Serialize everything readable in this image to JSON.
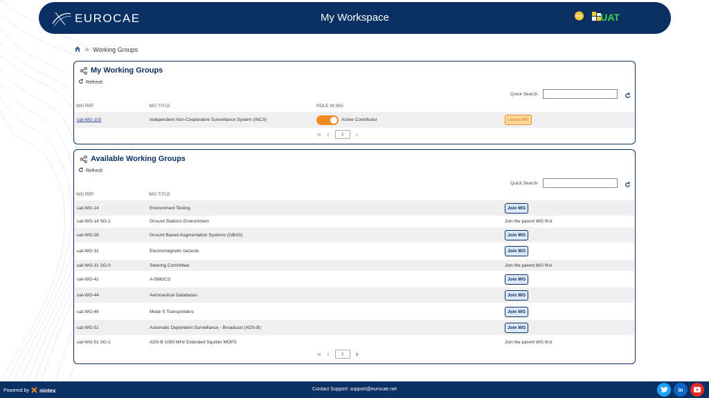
{
  "header": {
    "logo_text": "EUROCAE",
    "title": "My Workspace",
    "env_label": "UAT",
    "icons": [
      "chat-icon",
      "org-chart-icon"
    ]
  },
  "breadcrumb": {
    "current": "Working Groups"
  },
  "my_groups": {
    "title": "My Working Groups",
    "refresh_label": "Refresh",
    "quick_search_label": "Quick Search:",
    "columns": {
      "ref": "WG REF",
      "title": "WG TITLE",
      "role": "ROLE IN WG"
    },
    "rows": [
      {
        "ref": "uat-WG-103",
        "title": "Independent Non-Cooperative Surveillance System (INCS)",
        "role": "Active Contributor",
        "action": "Leave WG"
      }
    ],
    "page": "1"
  },
  "available_groups": {
    "title": "Available Working Groups",
    "refresh_label": "Refresh",
    "quick_search_label": "Quick Search:",
    "columns": {
      "ref": "WG REF",
      "title": "WG TITLE"
    },
    "rows": [
      {
        "ref": "uat-WG-14",
        "title": "Environment Testing",
        "action": "Join WG"
      },
      {
        "ref": "uat-WG-14 SG-1",
        "title": "Ground Stations Environment",
        "action": "Join the parent WG first"
      },
      {
        "ref": "uat-WG-28",
        "title": "Ground Based Augmentation Systems (GBAS)",
        "action": "Join WG"
      },
      {
        "ref": "uat-WG-31",
        "title": "Electromagnetic hazards",
        "action": "Join WG"
      },
      {
        "ref": "uat-WG-31 SG-0",
        "title": "Steering Committee",
        "action": "Join the parent WG first"
      },
      {
        "ref": "uat-WG-41",
        "title": "A-SMGCS",
        "action": "Join WG"
      },
      {
        "ref": "uat-WG-44",
        "title": "Aeronautical Databases",
        "action": "Join WG"
      },
      {
        "ref": "uat-WG-49",
        "title": "Mode S Transponders",
        "action": "Join WG"
      },
      {
        "ref": "uat-WG-51",
        "title": "Automatic Dependent Surveillance - Broadcast (ADS-B)",
        "action": "Join WG"
      },
      {
        "ref": "uat-WG-51 SG-1",
        "title": "ADS-B 1090 MHz Extended Squitter MOPS",
        "action": "Join the parent WG first"
      }
    ],
    "page": "1"
  },
  "footer": {
    "powered_by": "Powered by",
    "brand": "nintex",
    "support": "Contact Support: support@eurocae.net",
    "social": [
      "twitter-icon",
      "linkedin-icon",
      "youtube-icon"
    ]
  },
  "colors": {
    "navy": "#0a2f62",
    "orange": "#f08a24",
    "uat_green": "#3cd04a"
  }
}
